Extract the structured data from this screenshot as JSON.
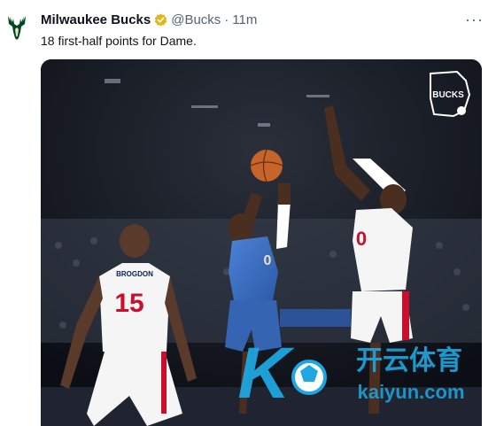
{
  "tweet": {
    "author_name": "Milwaukee Bucks",
    "handle": "@Bucks",
    "separator": "·",
    "time": "11m",
    "text": "18 first-half points for Dame.",
    "more_icon": "more-horizontal-icon",
    "verified_icon": "verified-badge-icon"
  },
  "media": {
    "logo_text": "BUCKS",
    "player_numbers": {
      "left_defender": "15",
      "left_defender_name": "BROGDON",
      "shooter": "0",
      "right_defender": "0"
    },
    "watermark_cn": "开云体育",
    "watermark_url": "kaiyun.com",
    "watermark_logo_letter": "K"
  },
  "colors": {
    "bucks_green": "#00471b",
    "cream": "#eee1c6",
    "bucks_blue": "#3a6fc4",
    "wizards_red": "#c8102e",
    "watermark_blue": "#1ea7e0",
    "verified_gold": "#e2b719"
  }
}
